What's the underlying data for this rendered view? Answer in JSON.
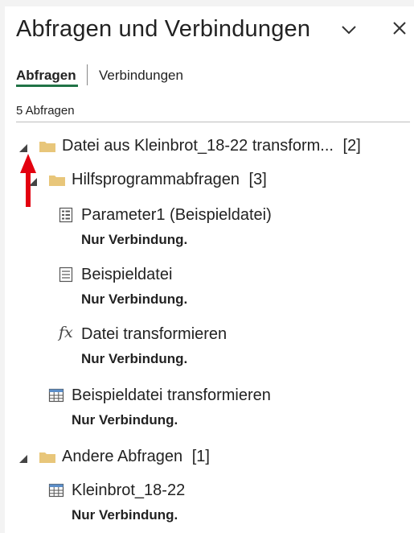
{
  "panel": {
    "title": "Abfragen und Verbindungen"
  },
  "tabs": {
    "queries_label": "Abfragen",
    "connections_label": "Verbindungen"
  },
  "summary": {
    "count_text": "5 Abfragen"
  },
  "tree": {
    "group1": {
      "label": "Datei aus Kleinbrot_18-22 transform...",
      "count": "[2]"
    },
    "helper": {
      "label": "Hilfsprogrammabfragen",
      "count": "[3]"
    },
    "items": [
      {
        "name": "Parameter1 (Beispieldatei)",
        "status": "Nur Verbindung.",
        "icon": "parameter-icon"
      },
      {
        "name": "Beispieldatei",
        "status": "Nur Verbindung.",
        "icon": "document-icon"
      },
      {
        "name": "Datei transformieren",
        "status": "Nur Verbindung.",
        "icon": "function-fx-icon"
      },
      {
        "name": "Beispieldatei transformieren",
        "status": "Nur Verbindung.",
        "icon": "table-icon"
      }
    ],
    "group2": {
      "label": "Andere Abfragen",
      "count": "[1]"
    },
    "other_items": [
      {
        "name": "Kleinbrot_18-22",
        "status": "Nur Verbindung.",
        "icon": "table-icon"
      }
    ]
  },
  "colors": {
    "accent_green": "#217346",
    "folder_fill": "#e8c67a",
    "annotation_red": "#e3000f"
  }
}
